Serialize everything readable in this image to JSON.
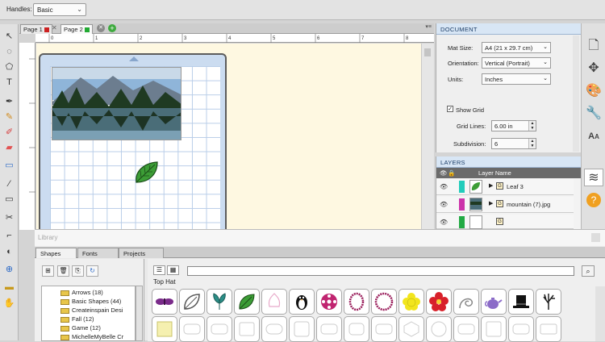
{
  "toolbar": {
    "handles_label": "Handles:",
    "handles_value": "Basic"
  },
  "tabs": [
    {
      "label": "Page 1",
      "color": "#cc2222"
    },
    {
      "label": "Page 2",
      "color": "#22aa33"
    }
  ],
  "ruler_marks": [
    "0",
    "1",
    "2",
    "3",
    "4",
    "5",
    "6",
    "7",
    "8"
  ],
  "document": {
    "title": "DOCUMENT",
    "mat_size_label": "Mat Size:",
    "mat_size_value": "A4 (21 x 29.7 cm)",
    "orientation_label": "Orientation:",
    "orientation_value": "Vertical (Portrait)",
    "units_label": "Units:",
    "units_value": "Inches",
    "show_grid_label": "Show Grid",
    "show_grid_checked": true,
    "grid_lines_label": "Grid Lines:",
    "grid_lines_value": "6.00 in",
    "subdivision_label": "Subdivision:",
    "subdivision_value": "6"
  },
  "layers": {
    "title": "LAYERS",
    "column_label": "Layer Name",
    "rows": [
      {
        "name": "Leaf 3",
        "color": "#22ccbb"
      },
      {
        "name": "mountain (7).jpg",
        "color": "#cc33aa"
      },
      {
        "name": "",
        "color": "#22aa44"
      }
    ]
  },
  "library": {
    "title": "Library",
    "tabs": [
      "Shapes",
      "Fonts",
      "Projects"
    ],
    "folders": [
      "Arrows (18)",
      "Basic Shapes (44)",
      "Createinspain Desi",
      "Fall (12)",
      "Game (12)",
      "MichelleMyBelle Cr"
    ],
    "current_set": "Top Hat",
    "shape_icons": [
      "butterfly-purple",
      "leaf-outline",
      "leaf-teal",
      "leaf-green",
      "ornament-pink",
      "penguin",
      "flower-magenta",
      "oval-frame",
      "circle-frame",
      "flower-yellow",
      "flower-red",
      "swirl",
      "teapot",
      "top-hat",
      "tree-bare"
    ]
  },
  "colors": {
    "accent_blue": "#1a3c66",
    "canvas_bg": "#fef8e1",
    "mat_blue": "#cbdcf0"
  }
}
